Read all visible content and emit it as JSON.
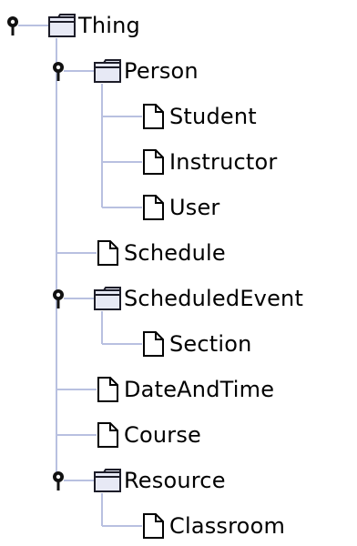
{
  "tree": {
    "nodes": [
      {
        "label": "Thing",
        "kind": "folder",
        "expanded": true,
        "depth": 0
      },
      {
        "label": "Person",
        "kind": "folder",
        "expanded": true,
        "depth": 1
      },
      {
        "label": "Student",
        "kind": "leaf",
        "depth": 2
      },
      {
        "label": "Instructor",
        "kind": "leaf",
        "depth": 2
      },
      {
        "label": "User",
        "kind": "leaf",
        "depth": 2
      },
      {
        "label": "Schedule",
        "kind": "leaf",
        "depth": 1
      },
      {
        "label": "ScheduledEvent",
        "kind": "folder",
        "expanded": true,
        "depth": 1
      },
      {
        "label": "Section",
        "kind": "leaf",
        "depth": 2
      },
      {
        "label": "DateAndTime",
        "kind": "leaf",
        "depth": 1
      },
      {
        "label": "Course",
        "kind": "leaf",
        "depth": 1
      },
      {
        "label": "Resource",
        "kind": "folder",
        "expanded": true,
        "depth": 1
      },
      {
        "label": "Classroom",
        "kind": "leaf",
        "depth": 2
      }
    ]
  },
  "colors": {
    "tree_line": "#b8c0e0",
    "folder_fill": "#e7e9f5",
    "folder_stroke": "#1c1c28",
    "page_fill": "#ffffff",
    "page_stroke": "#000000",
    "toggle": "#111111",
    "text": "#000000"
  }
}
